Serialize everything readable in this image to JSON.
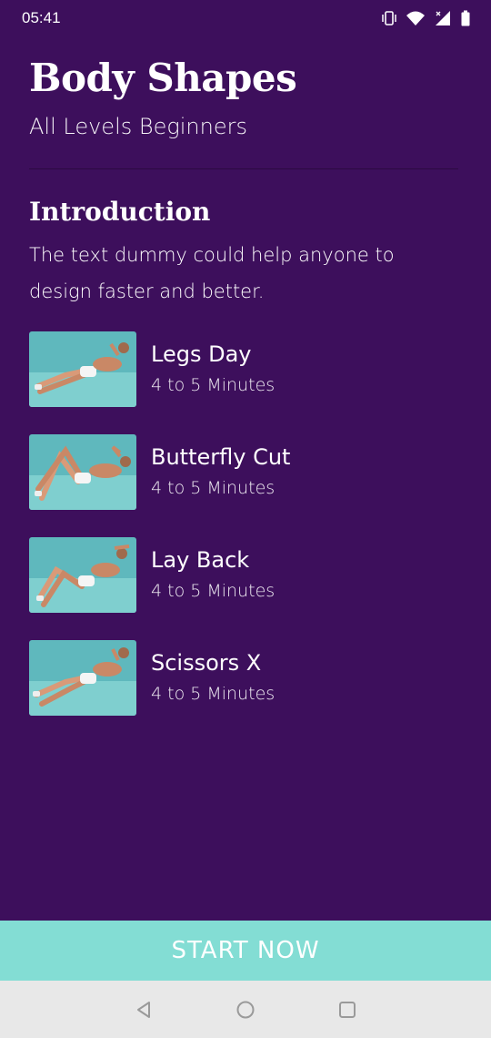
{
  "status_bar": {
    "time": "05:41",
    "icons": [
      "vibrate-icon",
      "wifi-icon",
      "signal-icon",
      "battery-icon"
    ]
  },
  "header": {
    "title": "Body Shapes",
    "subtitle": "All Levels Beginners"
  },
  "intro": {
    "title": "Introduction",
    "text": "The text dummy could help anyone to design faster and better."
  },
  "exercises": [
    {
      "name": "Legs Day",
      "duration": "4 to 5 Minutes",
      "pose": "legs-raised"
    },
    {
      "name": "Butterfly Cut",
      "duration": "4 to 5 Minutes",
      "pose": "knees-up"
    },
    {
      "name": "Lay Back",
      "duration": "4 to 5 Minutes",
      "pose": "crunch"
    },
    {
      "name": "Scissors X",
      "duration": "4 to 5 Minutes",
      "pose": "legs-raised"
    }
  ],
  "start_button": {
    "label": "START NOW"
  },
  "nav_bar": {
    "icons": [
      "back-icon",
      "home-icon",
      "recents-icon"
    ]
  },
  "colors": {
    "background": "#3d0f5c",
    "accent": "#83ddd4",
    "nav_background": "#e8e8e8"
  }
}
